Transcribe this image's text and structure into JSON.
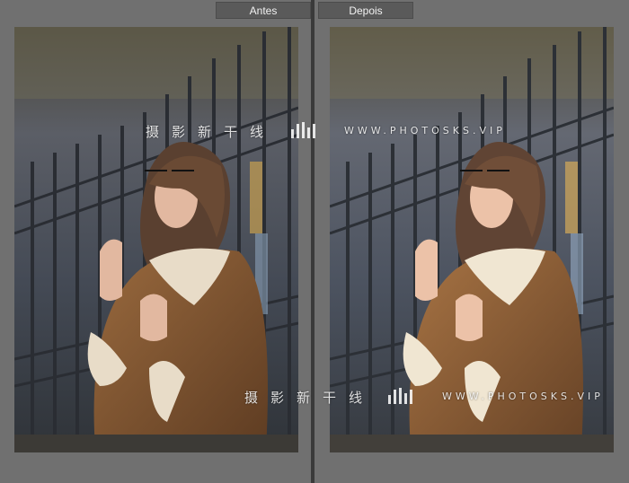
{
  "compare_view": {
    "before_label": "Antes",
    "after_label": "Depois"
  },
  "watermark": {
    "chinese_text": "摄影新干线",
    "site_text": "WWW.PHOTOSKS.VIP"
  },
  "colors": {
    "background": "#6b6b6b",
    "tab_background": "#5a5a5a",
    "divider": "#3a3a3a"
  }
}
